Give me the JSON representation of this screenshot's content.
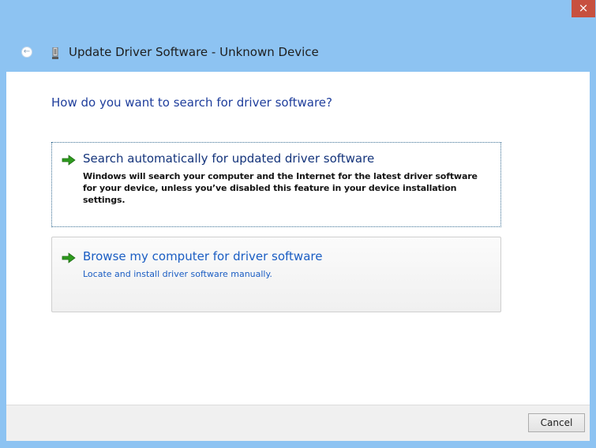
{
  "window": {
    "title": "Update Driver Software - Unknown Device",
    "close_glyph": "×",
    "back_glyph": "←"
  },
  "main": {
    "question": "How do you want to search for driver software?",
    "options": [
      {
        "title": "Search automatically for updated driver software",
        "description": "Windows will search your computer and the Internet for the latest driver software for your device, unless you’ve disabled this feature in your device installation settings.",
        "icon": "green-arrow-icon"
      },
      {
        "title": "Browse my computer for driver software",
        "description": "Locate and install driver software manually.",
        "icon": "green-arrow-icon"
      }
    ]
  },
  "footer": {
    "cancel_label": "Cancel"
  },
  "colors": {
    "titlebar": "#8dc3f2",
    "close_button": "#c7503f",
    "heading_text": "#1f3e9c",
    "link_text": "#1a5dc3",
    "arrow_green": "#2e9b1e"
  }
}
